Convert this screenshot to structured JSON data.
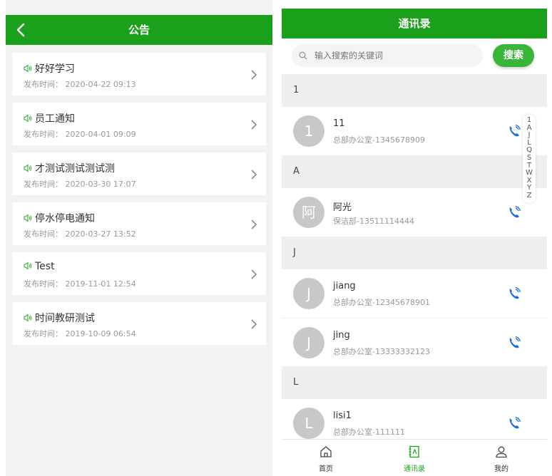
{
  "left": {
    "title": "公告",
    "notices": [
      {
        "title": "好好学习",
        "time": "发布时间：  2020-04-22 09:13"
      },
      {
        "title": "员工通知",
        "time": "发布时间：  2020-04-01 09:09"
      },
      {
        "title": "才测试测试测试测",
        "time": "发布时间：  2020-03-30 17:07"
      },
      {
        "title": "停水停电通知",
        "time": "发布时间：  2020-03-27 13:52"
      },
      {
        "title": "Test",
        "time": "发布时间：  2019-11-01 12:54"
      },
      {
        "title": "时间教研测试",
        "time": "发布时间：  2019-10-09 06:54"
      }
    ]
  },
  "right": {
    "title": "通讯录",
    "search": {
      "placeholder": "输入搜索的关键词",
      "button": "搜索"
    },
    "sections": [
      {
        "label": "1",
        "contacts": [
          {
            "avatar": "1",
            "name": "11",
            "dept": "总部办公室-1345678909"
          }
        ]
      },
      {
        "label": "A",
        "contacts": [
          {
            "avatar": "阿",
            "name": "阿光",
            "dept": "保洁部-13511114444"
          }
        ]
      },
      {
        "label": "J",
        "contacts": [
          {
            "avatar": "J",
            "name": "jiang",
            "dept": "总部办公室-12345678901"
          },
          {
            "avatar": "J",
            "name": "jing",
            "dept": "总部办公室-13333332123"
          }
        ]
      },
      {
        "label": "L",
        "contacts": [
          {
            "avatar": "L",
            "name": "lisi1",
            "dept": "总部办公室-111111"
          }
        ]
      }
    ],
    "index_letters": [
      "1",
      "A",
      "J",
      "L",
      "Q",
      "S",
      "T",
      "W",
      "X",
      "Y",
      "Z"
    ],
    "tabs": [
      {
        "label": "首页",
        "icon": "home-icon"
      },
      {
        "label": "通讯录",
        "icon": "contacts-icon"
      },
      {
        "label": "我的",
        "icon": "user-icon"
      }
    ]
  },
  "colors": {
    "primary": "#1aa01a",
    "button": "#3ab53a",
    "phone": "#1a6ed8"
  }
}
